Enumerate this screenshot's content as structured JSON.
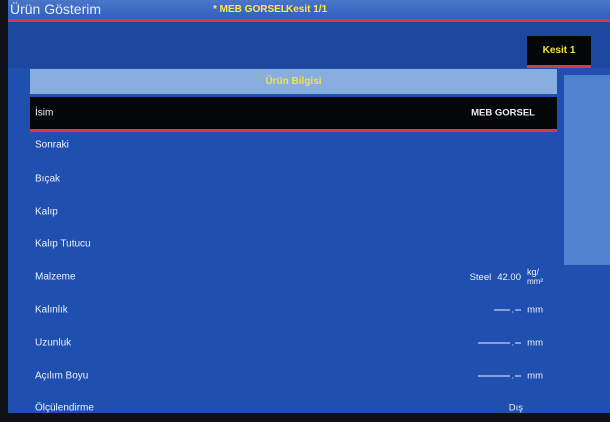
{
  "window": {
    "app_title": "Ürün Gösterim",
    "file_name": "* MEB GORSEL",
    "section_label": "Kesit 1/1"
  },
  "tab": {
    "label": "Kesit 1"
  },
  "panel": {
    "header": "Ürün Bilgisi"
  },
  "rows": [
    {
      "label": "İsim",
      "value": "MEB GORSEL"
    },
    {
      "label": "Sonraki",
      "value": ""
    },
    {
      "label": "Bıçak",
      "value": ""
    },
    {
      "label": "Kalıp",
      "value": ""
    },
    {
      "label": "Kalıp Tutucu",
      "value": ""
    },
    {
      "label": "Malzeme",
      "material": "Steel",
      "number": "42.00",
      "unit_top": "kg/",
      "unit_bottom": "mm²"
    },
    {
      "label": "Kalınlık",
      "value": ".",
      "unit": "mm"
    },
    {
      "label": "Uzunluk",
      "value": ".",
      "unit": "mm"
    },
    {
      "label": "Açılım Boyu",
      "value": ".",
      "unit": "mm"
    },
    {
      "label": "Ölçülendirme",
      "value": "Dış"
    }
  ],
  "colors": {
    "background": "#1f4faf",
    "accent_line": "#d6384e",
    "highlight_text": "#f2e53e",
    "header_bg": "#87aede"
  }
}
